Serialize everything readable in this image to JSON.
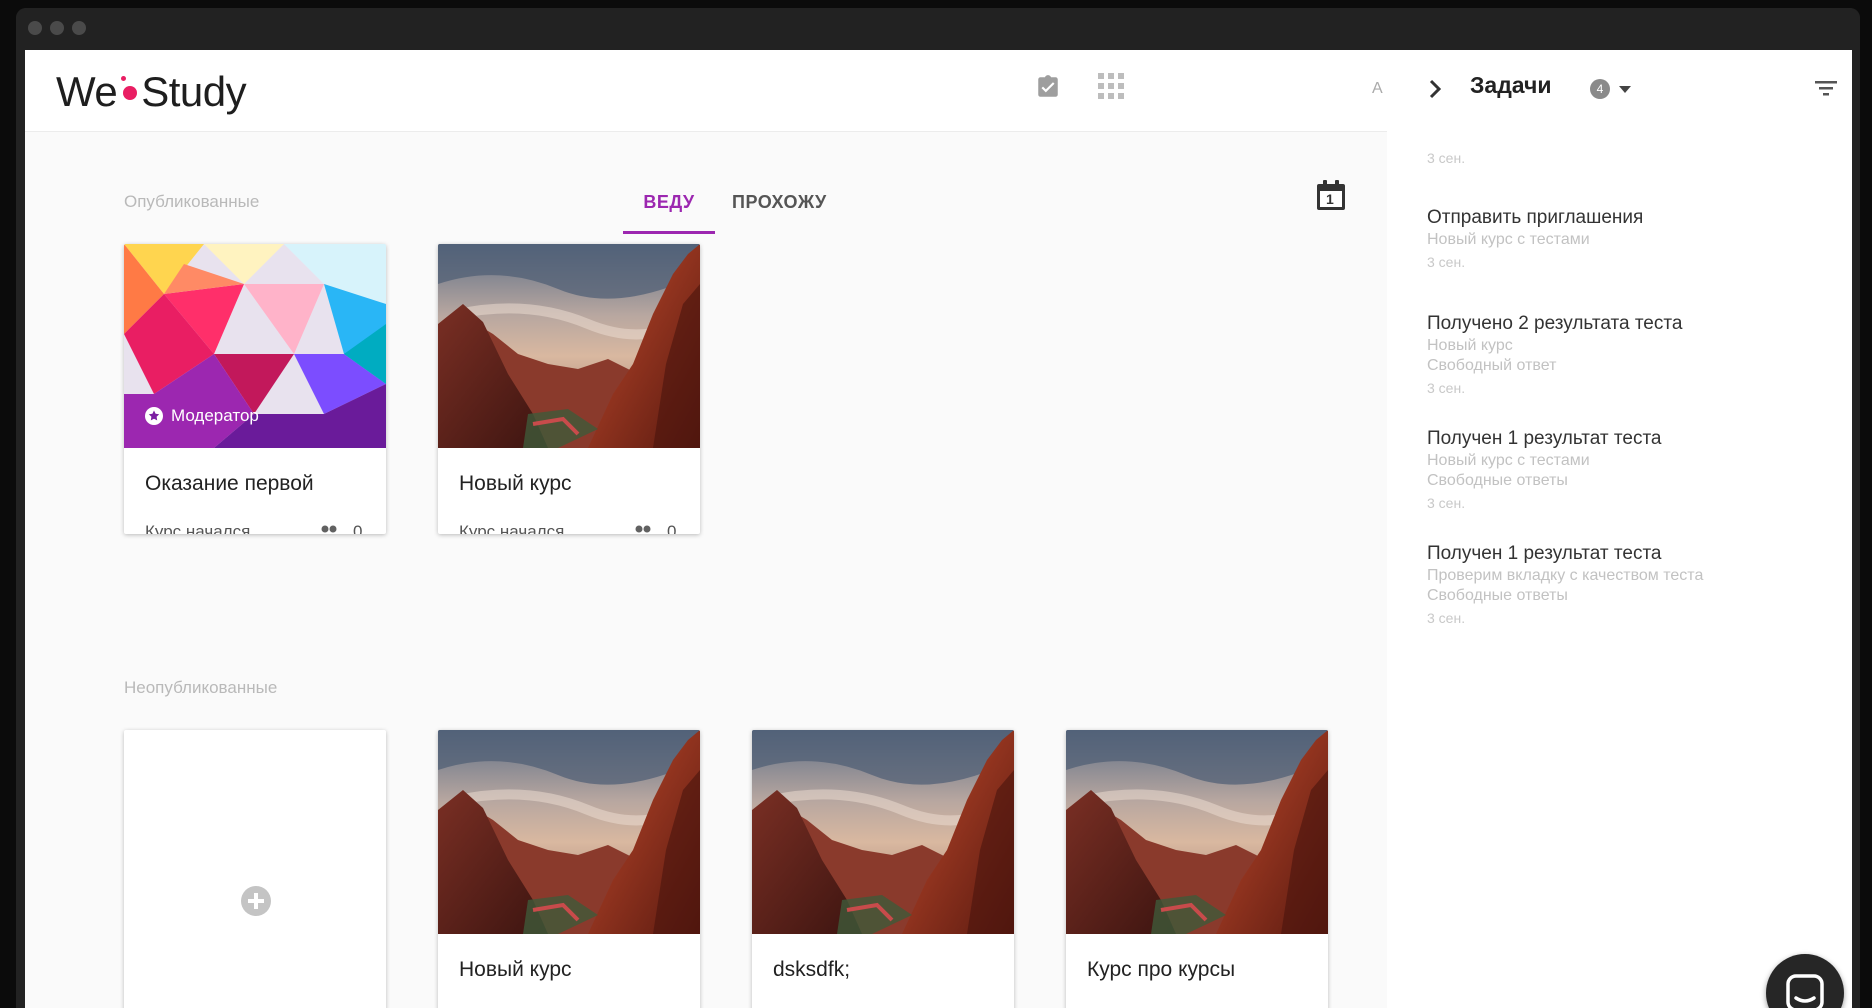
{
  "header": {
    "logo_left": "We",
    "logo_right": "Study",
    "a_label": "A"
  },
  "main": {
    "published_title": "Опубликованные",
    "unpublished_title": "Неопубликованные",
    "tabs": [
      {
        "label": "ВЕДУ",
        "active": true
      },
      {
        "label": "ПРОХОЖУ",
        "active": false
      }
    ],
    "calendar_day": "1",
    "published_courses": [
      {
        "title": "Оказание первой",
        "status": "Курс начался",
        "count": "0",
        "badge": "Модератор",
        "image": "abstract-polygon"
      },
      {
        "title": "Новый курс",
        "status": "Курс начался",
        "count": "0",
        "image": "canyon"
      }
    ],
    "unpublished_courses": [
      {
        "title": "Новый курс",
        "image": "canyon"
      },
      {
        "title": "dsksdfk;",
        "image": "canyon"
      },
      {
        "title": "Курс про курсы",
        "image": "canyon"
      }
    ]
  },
  "tasks_panel": {
    "title": "Задачи",
    "count": "4",
    "top_date": "3 сен.",
    "tasks": [
      {
        "title": "Отправить приглашения",
        "lines": [
          "Новый курс с тестами"
        ],
        "date": "3 сен."
      },
      {
        "title": "Получено 2 результата теста",
        "lines": [
          "Новый курс",
          "Свободный ответ"
        ],
        "date": "3 сен."
      },
      {
        "title": "Получен 1 результат теста",
        "lines": [
          "Новый курс с тестами",
          "Свободные ответы"
        ],
        "date": "3 сен."
      },
      {
        "title": "Получен 1 результат теста",
        "lines": [
          "Проверим вкладку с качеством теста",
          "Свободные ответы"
        ],
        "date": "3 сен."
      }
    ]
  },
  "colors": {
    "accent": "#9c27b0",
    "logo_dot": "#e91e63"
  }
}
